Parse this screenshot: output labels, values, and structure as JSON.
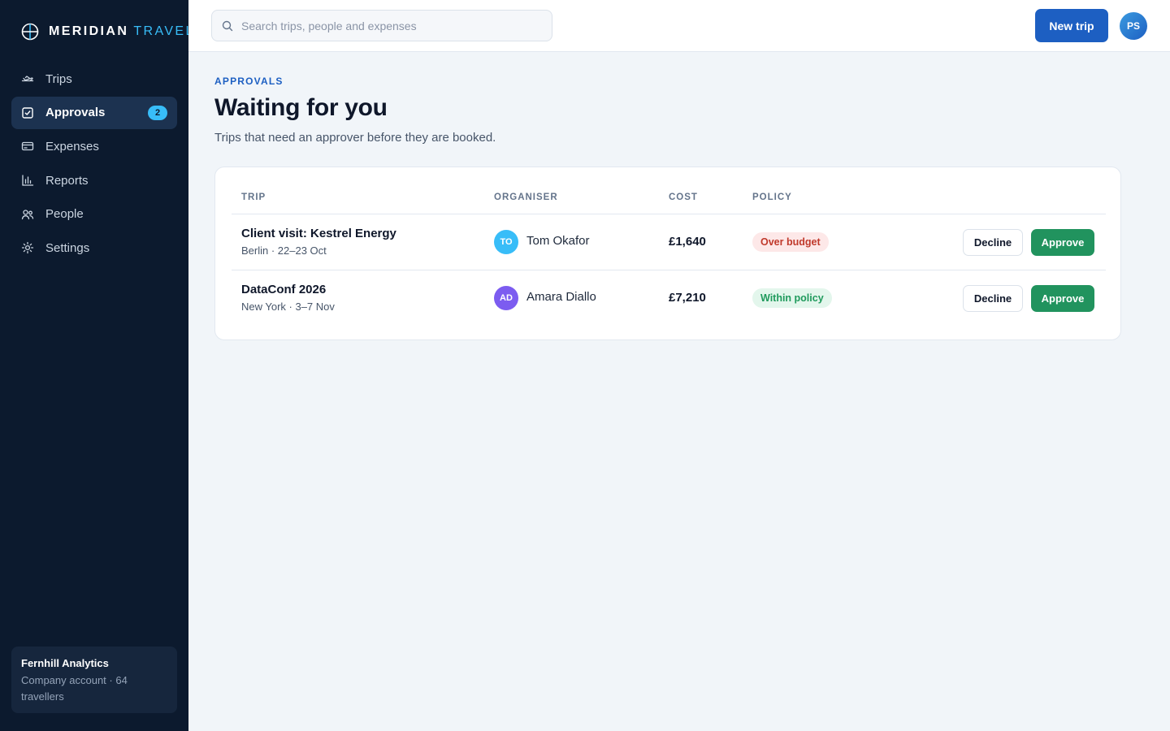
{
  "brand": {
    "name": "MERIDIAN",
    "accent": "TRAVEL"
  },
  "nav": [
    {
      "label": "Trips",
      "icon": "plane-icon",
      "active": false
    },
    {
      "label": "Approvals",
      "icon": "check-square-icon",
      "active": true,
      "badge": "2"
    },
    {
      "label": "Expenses",
      "icon": "card-icon",
      "active": false
    },
    {
      "label": "Reports",
      "icon": "bar-chart-icon",
      "active": false
    },
    {
      "label": "People",
      "icon": "people-icon",
      "active": false
    },
    {
      "label": "Settings",
      "icon": "gear-icon",
      "active": false
    }
  ],
  "org": {
    "name": "Fernhill Analytics",
    "meta": "Company account · 64 travellers"
  },
  "search": {
    "placeholder": "Search trips, people and expenses",
    "value": ""
  },
  "topbar": {
    "new_trip_label": "New trip",
    "user_initials": "PS"
  },
  "page": {
    "eyebrow": "APPROVALS",
    "title": "Waiting for you",
    "subtitle": "Trips that need an approver before they are booked."
  },
  "table": {
    "headers": {
      "trip": "TRIP",
      "organiser": "ORGANISER",
      "cost": "COST",
      "policy": "POLICY"
    },
    "rows": [
      {
        "trip": "Client visit: Kestrel Energy",
        "meta": "Berlin · 22–23 Oct",
        "initials": "TO",
        "organiser": "Tom Okafor",
        "avatar_color": "#38bdf8",
        "cost": "£1,640",
        "policy": "Over budget",
        "policy_status": "bad",
        "decline_label": "Decline",
        "approve_label": "Approve"
      },
      {
        "trip": "DataConf 2026",
        "meta": "New York · 3–7 Nov",
        "initials": "AD",
        "organiser": "Amara Diallo",
        "avatar_color": "#7c5cf0",
        "cost": "£7,210",
        "policy": "Within policy",
        "policy_status": "good",
        "decline_label": "Decline",
        "approve_label": "Approve"
      }
    ]
  },
  "colors": {
    "sidebar_bg": "#0c1a2e",
    "accent": "#38bdf8",
    "primary": "#1d5fc2",
    "approve": "#21935e",
    "danger": "#c0392b",
    "success": "#1f9a5c"
  }
}
